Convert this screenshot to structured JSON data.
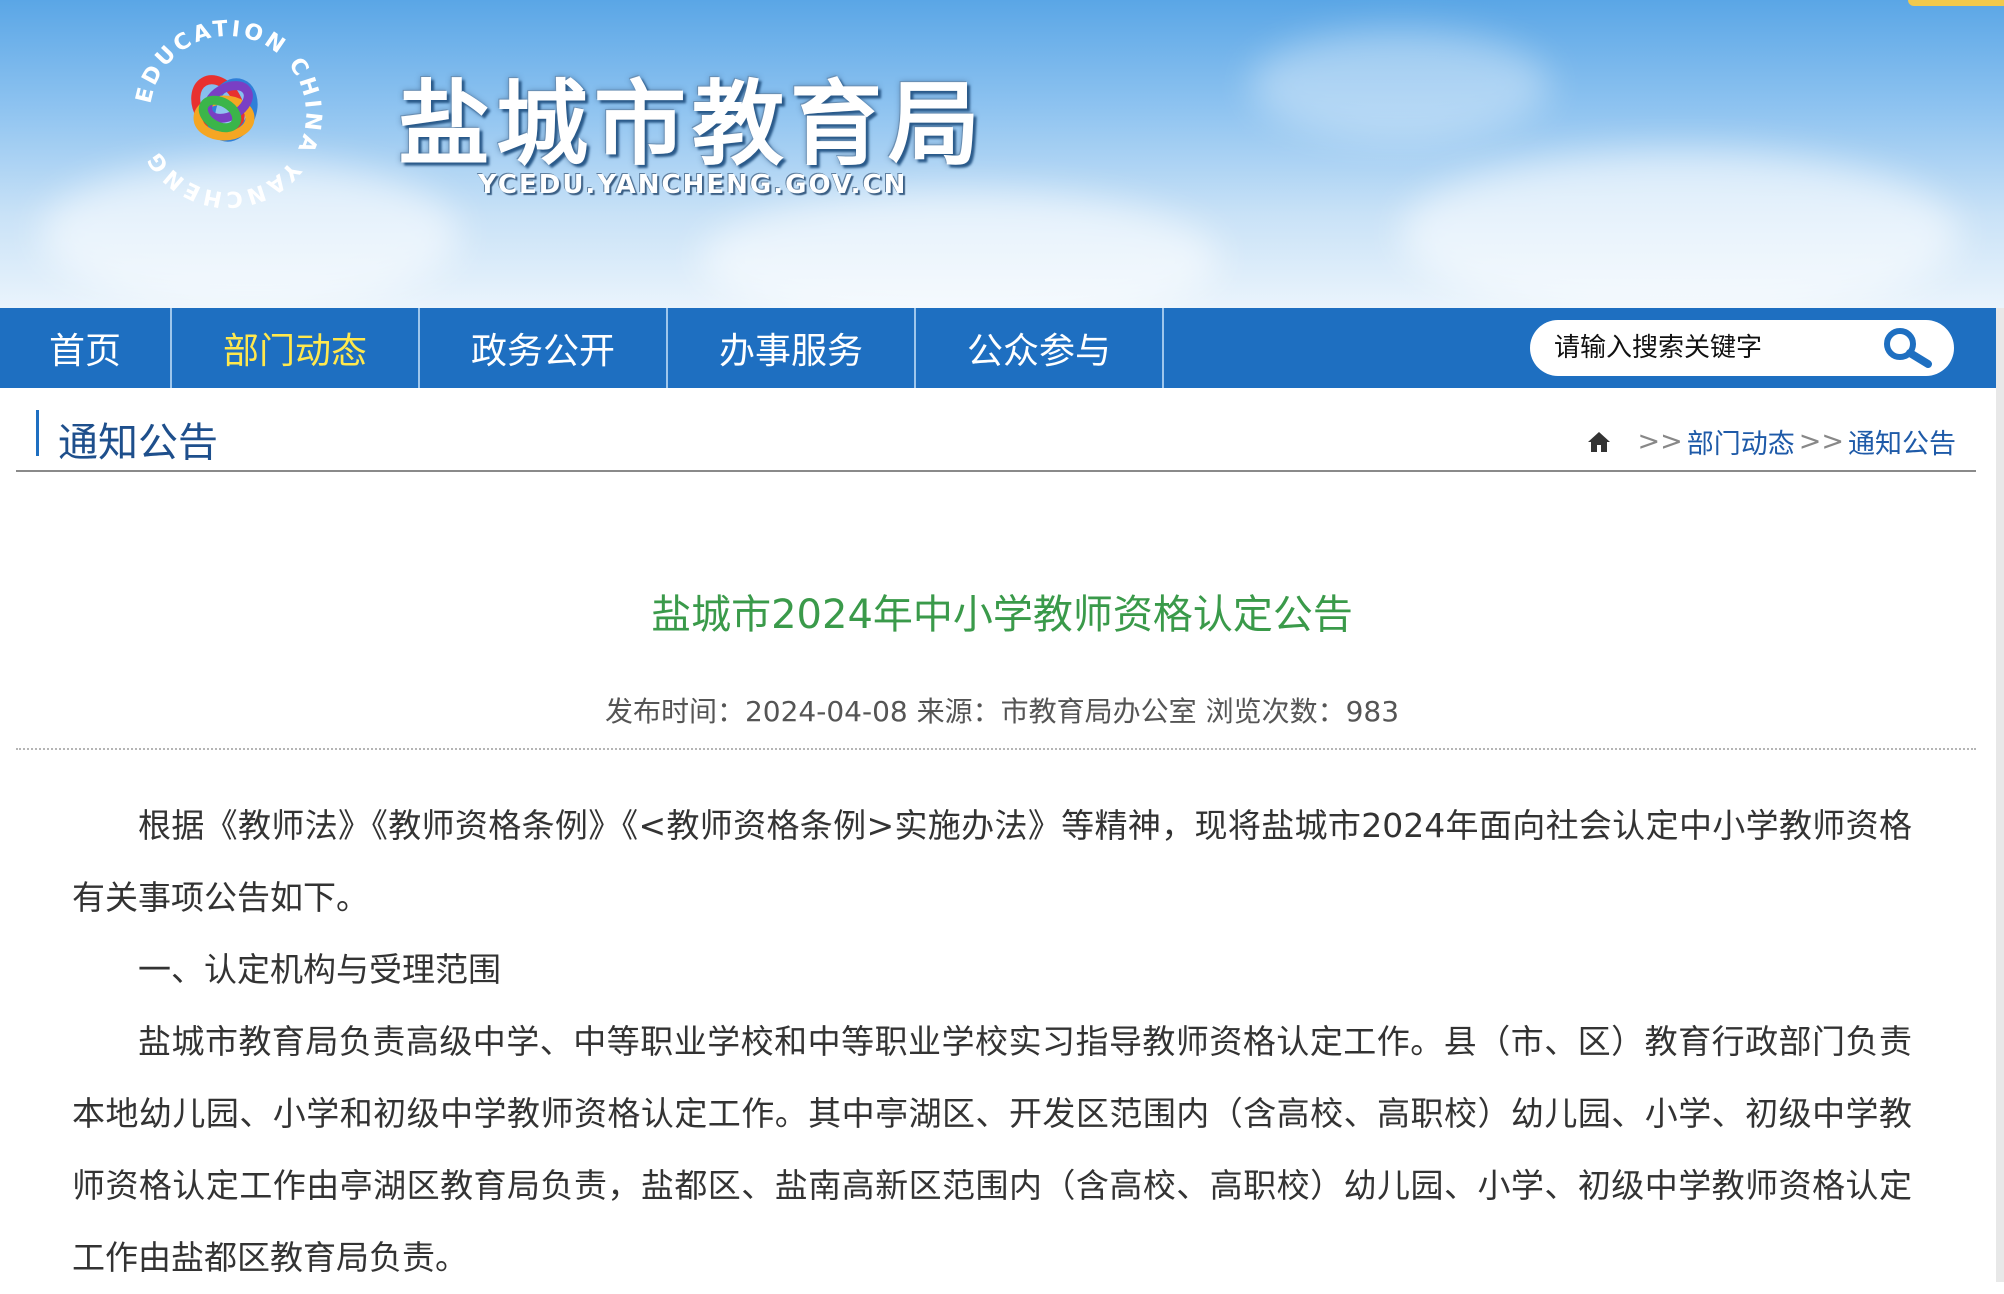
{
  "header": {
    "logo_ring_text": "EDUCATION CHINA YANCHENG",
    "site_title": "盐城市教育局",
    "site_domain": "YCEDU.YANCHENG.GOV.CN"
  },
  "nav": {
    "items": [
      {
        "label": "首页",
        "active": false
      },
      {
        "label": "部门动态",
        "active": true
      },
      {
        "label": "政务公开",
        "active": false
      },
      {
        "label": "办事服务",
        "active": false
      },
      {
        "label": "公众参与",
        "active": false
      }
    ],
    "search_placeholder": "请输入搜索关键字"
  },
  "section": {
    "title": "通知公告",
    "breadcrumb": {
      "sep1": ">>",
      "crumb1": "部门动态",
      "sep2": ">>",
      "crumb2": "通知公告"
    }
  },
  "article": {
    "title": "盐城市2024年中小学教师资格认定公告",
    "meta_publish_label": "发布时间：",
    "meta_publish_date": "2024-04-08",
    "meta_source_label": "来源：",
    "meta_source": "市教育局办公室",
    "meta_views_label": "浏览次数：",
    "meta_views": "983",
    "paragraphs": [
      "根据《教师法》《教师资格条例》《<教师资格条例>实施办法》等精神，现将盐城市2024年面向社会认定中小学教师资格有关事项公告如下。",
      "一、认定机构与受理范围",
      "盐城市教育局负责高级中学、中等职业学校和中等职业学校实习指导教师资格认定工作。县（市、区）教育行政部门负责本地幼儿园、小学和初级中学教师资格认定工作。其中亭湖区、开发区范围内（含高校、高职校）幼儿园、小学、初级中学教师资格认定工作由亭湖区教育局负责，盐都区、盐南高新区范围内（含高校、高职校）幼儿园、小学、初级中学教师资格认定工作由盐都区教育局负责。"
    ]
  },
  "colors": {
    "nav_bg": "#1e6fc1",
    "nav_active": "#ffe84d",
    "title_green": "#3a9a4a",
    "link_blue": "#1e5aa8"
  }
}
